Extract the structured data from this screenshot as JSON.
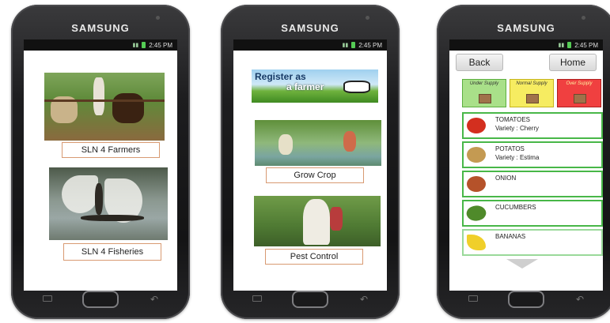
{
  "phones": [
    {
      "brand": "SAMSUNG",
      "time": "2:45 PM",
      "tiles": [
        {
          "label": "SLN 4 Farmers"
        },
        {
          "label": "SLN 4 Fisheries"
        }
      ]
    },
    {
      "brand": "SAMSUNG",
      "time": "2:45 PM",
      "banner": {
        "line1": "Register as",
        "line2": "a farmer"
      },
      "tiles": [
        {
          "label": "Grow Crop"
        },
        {
          "label": "Pest Control"
        }
      ]
    },
    {
      "brand": "SAMSUNG",
      "time": "2:45 PM",
      "nav": {
        "back": "Back",
        "home": "Home"
      },
      "legend": {
        "under": "Under Supply",
        "normal": "Normal Supply",
        "over": "Over Supply"
      },
      "items": [
        {
          "name": "TOMATOES",
          "variety": "Variety : Cherry",
          "color": "#d32f1f"
        },
        {
          "name": "POTATOS",
          "variety": "Variety : Estima",
          "color": "#c49a52"
        },
        {
          "name": "ONION",
          "variety": "",
          "color": "#b5522a"
        },
        {
          "name": "CUCUMBERS",
          "variety": "",
          "color": "#4f8a2a"
        },
        {
          "name": "BANANAS",
          "variety": "",
          "color": "#f0cf2a"
        }
      ]
    }
  ],
  "colors": {
    "under_supply": "#a9e089",
    "normal_supply": "#f6ec61",
    "over_supply": "#f04040",
    "list_border": "#48b748",
    "label_border": "#d89a72"
  }
}
